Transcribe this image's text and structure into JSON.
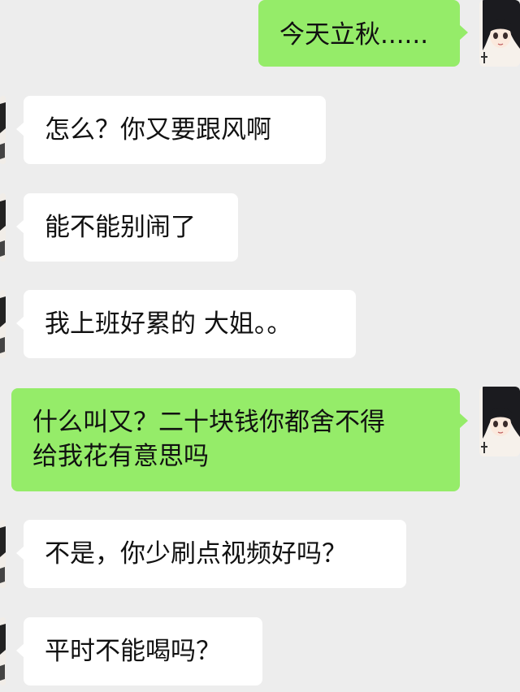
{
  "conversation": {
    "messages": [
      {
        "side": "out",
        "text": "今天立秋......"
      },
      {
        "side": "in",
        "text": "怎么？你又要跟风啊"
      },
      {
        "side": "in",
        "text": "能不能别闹了"
      },
      {
        "side": "in",
        "text": "我上班好累的 大姐。。"
      },
      {
        "side": "out",
        "text": "什么叫又？二十块钱你都舍不得\n给我花有意思吗"
      },
      {
        "side": "in",
        "text": "不是，你少刷点视频好吗？"
      },
      {
        "side": "in",
        "text": "平时不能喝吗？"
      }
    ]
  },
  "colors": {
    "background": "#ededed",
    "outgoing_bubble": "#95ec69",
    "incoming_bubble": "#ffffff"
  },
  "avatars": {
    "self_icon": "anime-girl-avatar-icon",
    "peer_icon": "peer-avatar-icon"
  }
}
